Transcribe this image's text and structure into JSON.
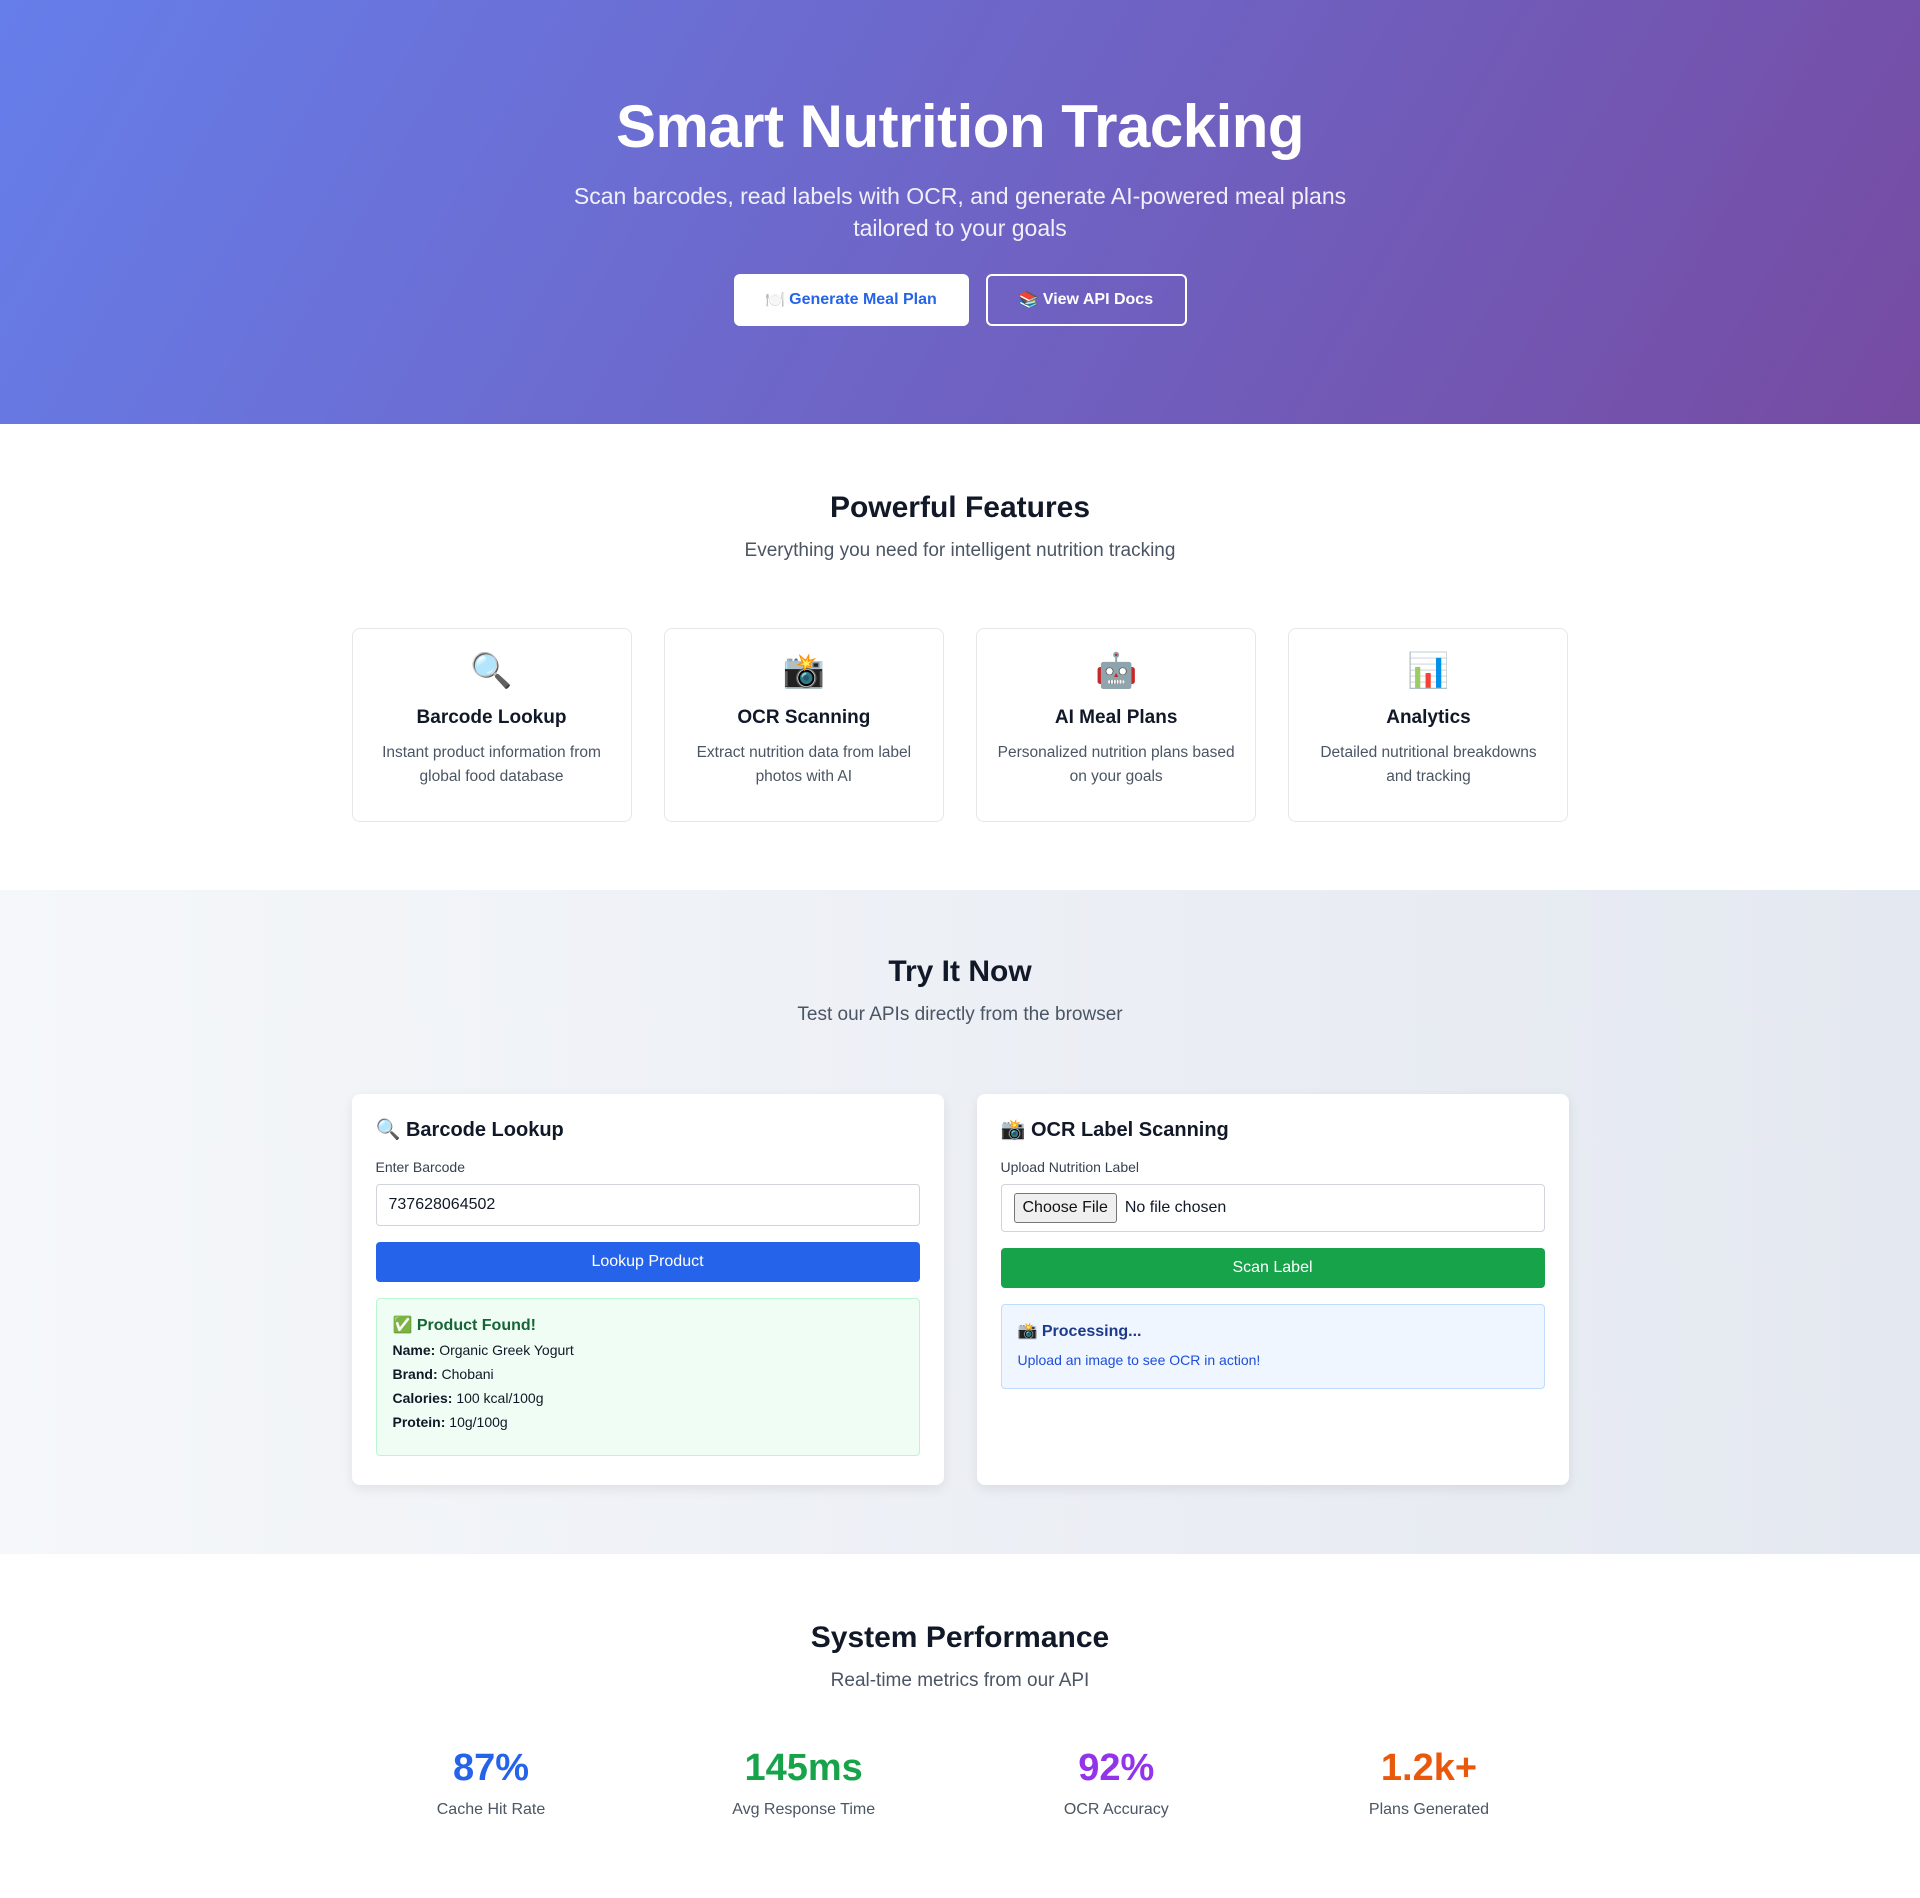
{
  "hero": {
    "title": "Smart Nutrition Tracking",
    "subtitle": "Scan barcodes, read labels with OCR, and generate AI-powered meal plans tailored to your goals",
    "primary_button": {
      "icon": "🍽️",
      "label": "Generate Meal Plan"
    },
    "secondary_button": {
      "icon": "📚",
      "label": "View API Docs"
    }
  },
  "features": {
    "title": "Powerful Features",
    "subtitle": "Everything you need for intelligent nutrition tracking",
    "cards": [
      {
        "icon": "🔍",
        "icon_name": "magnifier-icon",
        "title": "Barcode Lookup",
        "description": "Instant product information from global food database"
      },
      {
        "icon": "📸",
        "icon_name": "camera-flash-icon",
        "title": "OCR Scanning",
        "description": "Extract nutrition data from label photos with AI"
      },
      {
        "icon": "🤖",
        "icon_name": "robot-icon",
        "title": "AI Meal Plans",
        "description": "Personalized nutrition plans based on your goals"
      },
      {
        "icon": "📊",
        "icon_name": "bar-chart-icon",
        "title": "Analytics",
        "description": "Detailed nutritional breakdowns and tracking"
      }
    ]
  },
  "try_it": {
    "title": "Try It Now",
    "subtitle": "Test our APIs directly from the browser",
    "barcode": {
      "icon": "🔍",
      "title": "Barcode Lookup",
      "input_label": "Enter Barcode",
      "input_value": "737628064502",
      "button_label": "Lookup Product",
      "result": {
        "icon": "✅",
        "title": "Product Found!",
        "rows": [
          {
            "key": "Name:",
            "value": "Organic Greek Yogurt"
          },
          {
            "key": "Brand:",
            "value": "Chobani"
          },
          {
            "key": "Calories:",
            "value": "100 kcal/100g"
          },
          {
            "key": "Protein:",
            "value": "10g/100g"
          }
        ]
      }
    },
    "ocr": {
      "icon": "📸",
      "title": "OCR Label Scanning",
      "input_label": "Upload Nutrition Label",
      "file_button": "Choose File",
      "file_status": "No file chosen",
      "button_label": "Scan Label",
      "result": {
        "icon": "📸",
        "title": "Processing...",
        "text": "Upload an image to see OCR in action!"
      }
    }
  },
  "performance": {
    "title": "System Performance",
    "subtitle": "Real-time metrics from our API",
    "metrics": [
      {
        "value": "87%",
        "label": "Cache Hit Rate",
        "color": "#2563eb"
      },
      {
        "value": "145ms",
        "label": "Avg Response Time",
        "color": "#16a34a"
      },
      {
        "value": "92%",
        "label": "OCR Accuracy",
        "color": "#9333ea"
      },
      {
        "value": "1.2k+",
        "label": "Plans Generated",
        "color": "#ea580c"
      }
    ]
  },
  "colors": {
    "hero_gradient_start": "#667eea",
    "hero_gradient_end": "#764ba2",
    "primary_blue": "#2563eb",
    "success_green": "#16a34a"
  }
}
